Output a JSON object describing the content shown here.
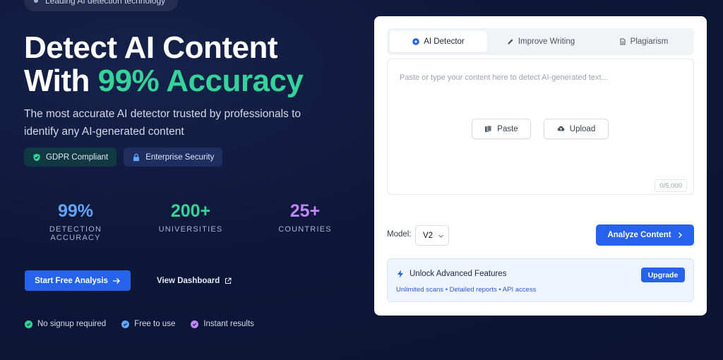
{
  "top_badge": {
    "text": "Leading AI detection technology"
  },
  "hero": {
    "title_line1": "Detect AI Content",
    "title_line2_prefix": "With ",
    "title_line2_accent": "99% Accuracy",
    "subtitle": "The most accurate AI detector trusted by professionals to identify any AI-generated content",
    "accent_color": "#34d399"
  },
  "pills": [
    {
      "label": "GDPR Compliant",
      "icon": "shield-check-icon",
      "color": "#34d399"
    },
    {
      "label": "Enterprise Security",
      "icon": "lock-icon",
      "color": "#60a5fa"
    }
  ],
  "stats": [
    {
      "value": "99%",
      "label": "DETECTION ACCURACY",
      "color": "#60a5fa"
    },
    {
      "value": "200+",
      "label": "UNIVERSITIES",
      "color": "#34d399"
    },
    {
      "value": "25+",
      "label": "COUNTRIES",
      "color": "#c084fc"
    }
  ],
  "cta": {
    "primary_label": "Start Free Analysis",
    "secondary_label": "View Dashboard"
  },
  "checks": [
    {
      "label": "No signup required",
      "color": "#34d399"
    },
    {
      "label": "Free to use",
      "color": "#60a5fa"
    },
    {
      "label": "Instant results",
      "color": "#c084fc"
    }
  ],
  "detector": {
    "tabs": [
      {
        "label": "AI Detector",
        "icon": "ai-dot-icon",
        "active": true
      },
      {
        "label": "Improve Writing",
        "icon": "pencil-icon",
        "active": false
      },
      {
        "label": "Plagiarism",
        "icon": "document-icon",
        "active": false
      }
    ],
    "editor_placeholder": "Paste or type your content here to detect AI-generated text...",
    "paste_label": "Paste",
    "upload_label": "Upload",
    "char_counter": "0/5,000",
    "model_label": "Model:",
    "model_value": "V2",
    "analyze_label": "Analyze Content",
    "unlock": {
      "title": "Unlock Advanced Features",
      "features": "Unlimited scans • Detailed reports • API access",
      "upgrade_label": "Upgrade"
    },
    "primary_color": "#2563eb"
  }
}
